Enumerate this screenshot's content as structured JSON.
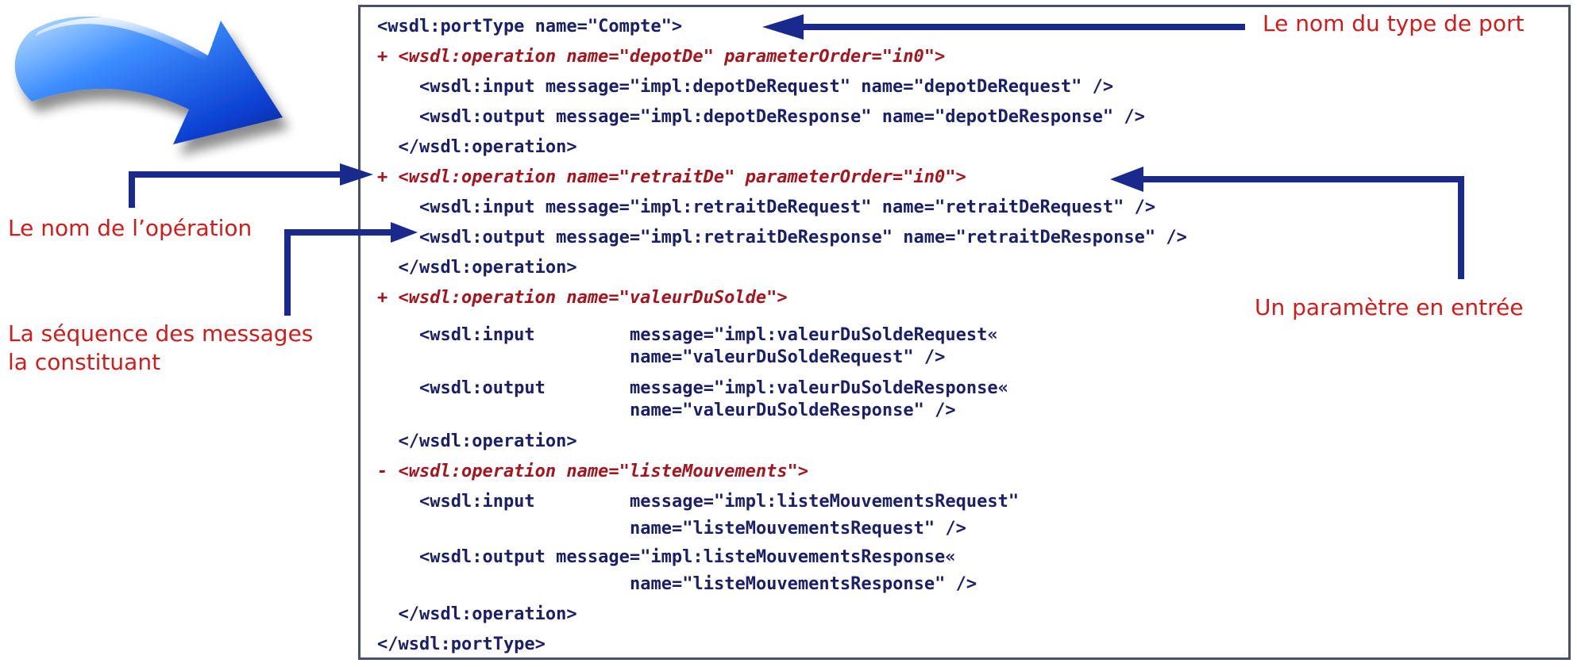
{
  "code": {
    "line_01": "<wsdl:portType name=\"Compte\">",
    "line_02": "+ <wsdl:operation name=\"depotDe\" parameterOrder=\"in0\">",
    "line_03": "    <wsdl:input message=\"impl:depotDeRequest\" name=\"depotDeRequest\" />",
    "line_04": "    <wsdl:output message=\"impl:depotDeResponse\" name=\"depotDeResponse\" />",
    "line_05": "  </wsdl:operation>",
    "line_06": "+ <wsdl:operation name=\"retraitDe\" parameterOrder=\"in0\">",
    "line_07": "    <wsdl:input message=\"impl:retraitDeRequest\" name=\"retraitDeRequest\" />",
    "line_08": "    <wsdl:output message=\"impl:retraitDeResponse\" name=\"retraitDeResponse\" />",
    "line_09": "  </wsdl:operation>",
    "line_10": "+ <wsdl:operation name=\"valeurDuSolde\">",
    "line_11a": "    <wsdl:input",
    "line_11b": "message=\"impl:valeurDuSoldeRequest«",
    "line_12": "name=\"valeurDuSoldeRequest\" />",
    "line_13a": "    <wsdl:output",
    "line_13b": "message=\"impl:valeurDuSoldeResponse«",
    "line_14": "name=\"valeurDuSoldeResponse\" />",
    "line_15": "  </wsdl:operation>",
    "line_16": "- <wsdl:operation name=\"listeMouvements\">",
    "line_17a": "    <wsdl:input",
    "line_17b": "message=\"impl:listeMouvementsRequest\"",
    "line_18": "name=\"listeMouvementsRequest\" />",
    "line_19": "    <wsdl:output message=\"impl:listeMouvementsResponse«",
    "line_20": "name=\"listeMouvementsResponse\" />",
    "line_21": "  </wsdl:operation>",
    "line_22": "</wsdl:portType>"
  },
  "annotations": {
    "port_type_name": "Le nom du type de port",
    "operation_name": "Le nom de l’opération",
    "message_sequence_line1": "La séquence des messages",
    "message_sequence_line2": "la constituant",
    "input_parameter": "Un paramètre en entrée"
  },
  "colors": {
    "code_text": "#1a1f66",
    "operation_text": "#a4161f",
    "annotation_text": "#cf1c1c",
    "arrow": "#1a2a8c",
    "panel_border": "#4a4f6e"
  },
  "icons": {
    "decorative_arrow": "glossy-blue-arrow-icon"
  }
}
